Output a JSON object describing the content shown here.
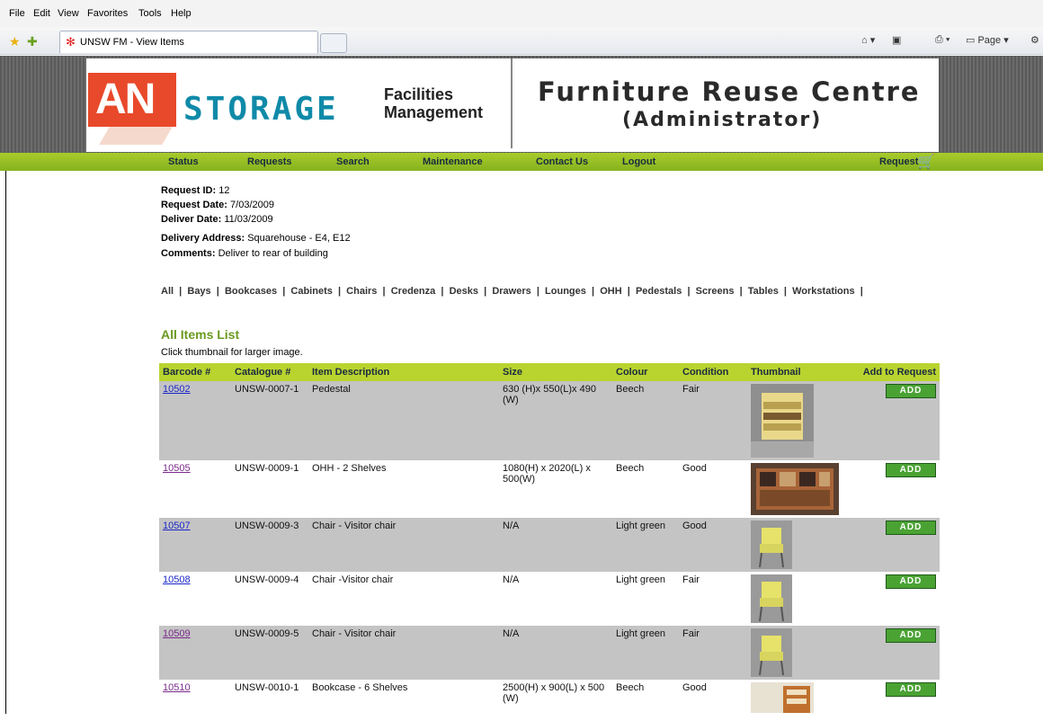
{
  "browser": {
    "menu": [
      "File",
      "Edit",
      "View",
      "Favorites",
      "Tools",
      "Help"
    ],
    "tab_title": "UNSW FM - View Items",
    "page_menu": "Page"
  },
  "banner": {
    "logo_letters": "AN",
    "logo_word": "STORAGE",
    "facilities_line1": "Facilities",
    "facilities_line2": "Management",
    "title": "Furniture Reuse Centre",
    "subtitle": "(Administrator)"
  },
  "nav": {
    "items": [
      "Status",
      "Requests",
      "Search",
      "Maintenance",
      "Contact Us",
      "Logout"
    ],
    "request_label": "Request"
  },
  "request": {
    "id_label": "Request ID:",
    "id": "12",
    "request_date_label": "Request Date:",
    "request_date": "7/03/2009",
    "deliver_date_label": "Deliver Date:",
    "deliver_date": "11/03/2009",
    "address_label": "Delivery Address:",
    "address": "Squarehouse - E4, E12",
    "comments_label": "Comments:",
    "comments": "Deliver to rear of building"
  },
  "categories": [
    "All",
    "Bays",
    "Bookcases",
    "Cabinets",
    "Chairs",
    "Credenza",
    "Desks",
    "Drawers",
    "Lounges",
    "OHH",
    "Pedestals",
    "Screens",
    "Tables",
    "Workstations"
  ],
  "list": {
    "title": "All Items List",
    "hint": "Click thumbnail for larger image."
  },
  "table": {
    "headers": [
      "Barcode #",
      "Catalogue #",
      "Item Description",
      "Size",
      "Colour",
      "Condition",
      "Thumbnail",
      "Add to Request"
    ],
    "add_label": "ADD",
    "rows": [
      {
        "barcode": "10502",
        "catalogue": "UNSW-0007-1",
        "description": "Pedestal",
        "size": "630 (H)x 550(L)x 490 (W)",
        "colour": "Beech",
        "condition": "Fair"
      },
      {
        "barcode": "10505",
        "catalogue": "UNSW-0009-1",
        "description": "OHH - 2 Shelves",
        "size": "1080(H) x 2020(L) x 500(W)",
        "colour": "Beech",
        "condition": "Good"
      },
      {
        "barcode": "10507",
        "catalogue": "UNSW-0009-3",
        "description": "Chair - Visitor chair",
        "size": "N/A",
        "colour": "Light green",
        "condition": "Good"
      },
      {
        "barcode": "10508",
        "catalogue": "UNSW-0009-4",
        "description": "Chair -Visitor chair",
        "size": "N/A",
        "colour": "Light green",
        "condition": "Fair"
      },
      {
        "barcode": "10509",
        "catalogue": "UNSW-0009-5",
        "description": "Chair - Visitor chair",
        "size": "N/A",
        "colour": "Light green",
        "condition": "Fair"
      },
      {
        "barcode": "10510",
        "catalogue": "UNSW-0010-1",
        "description": "Bookcase - 6 Shelves",
        "size": "2500(H) x 900(L) x 500 (W)",
        "colour": "Beech",
        "condition": "Good"
      }
    ]
  }
}
